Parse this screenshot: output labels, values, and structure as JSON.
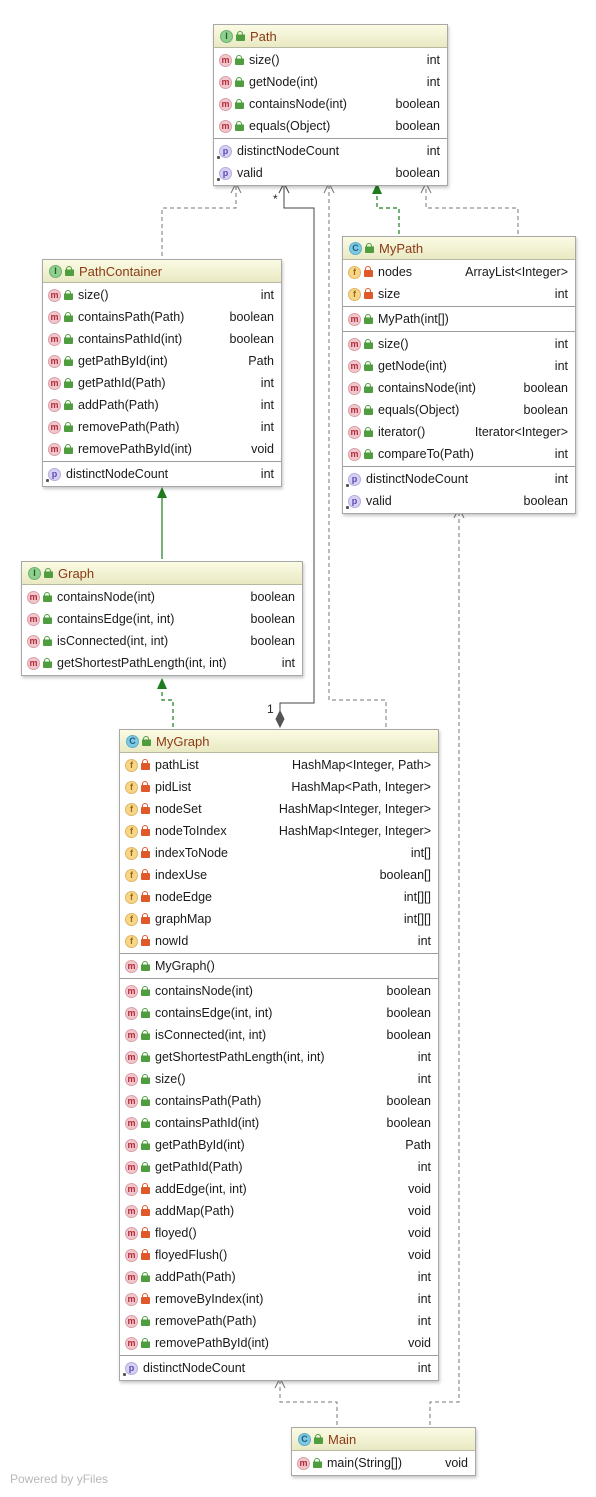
{
  "classes": {
    "path": {
      "kind": "I",
      "name": "Path",
      "methods": [
        {
          "name": "size()",
          "type": "int"
        },
        {
          "name": "getNode(int)",
          "type": "int"
        },
        {
          "name": "containsNode(int)",
          "type": "boolean"
        },
        {
          "name": "equals(Object)",
          "type": "boolean"
        }
      ],
      "properties": [
        {
          "name": "distinctNodeCount",
          "type": "int"
        },
        {
          "name": "valid",
          "type": "boolean"
        }
      ]
    },
    "pathcontainer": {
      "kind": "I",
      "name": "PathContainer",
      "methods": [
        {
          "name": "size()",
          "type": "int"
        },
        {
          "name": "containsPath(Path)",
          "type": "boolean"
        },
        {
          "name": "containsPathId(int)",
          "type": "boolean"
        },
        {
          "name": "getPathById(int)",
          "type": "Path"
        },
        {
          "name": "getPathId(Path)",
          "type": "int"
        },
        {
          "name": "addPath(Path)",
          "type": "int"
        },
        {
          "name": "removePath(Path)",
          "type": "int"
        },
        {
          "name": "removePathById(int)",
          "type": "void"
        }
      ],
      "properties": [
        {
          "name": "distinctNodeCount",
          "type": "int"
        }
      ]
    },
    "mypath": {
      "kind": "C",
      "name": "MyPath",
      "fields": [
        {
          "name": "nodes",
          "type": "ArrayList<Integer>"
        },
        {
          "name": "size",
          "type": "int"
        }
      ],
      "constructors": [
        {
          "name": "MyPath(int[])",
          "type": ""
        }
      ],
      "methods": [
        {
          "name": "size()",
          "type": "int"
        },
        {
          "name": "getNode(int)",
          "type": "int"
        },
        {
          "name": "containsNode(int)",
          "type": "boolean"
        },
        {
          "name": "equals(Object)",
          "type": "boolean"
        },
        {
          "name": "iterator()",
          "type": "Iterator<Integer>"
        },
        {
          "name": "compareTo(Path)",
          "type": "int"
        }
      ],
      "properties": [
        {
          "name": "distinctNodeCount",
          "type": "int"
        },
        {
          "name": "valid",
          "type": "boolean"
        }
      ]
    },
    "graph": {
      "kind": "I",
      "name": "Graph",
      "methods": [
        {
          "name": "containsNode(int)",
          "type": "boolean"
        },
        {
          "name": "containsEdge(int, int)",
          "type": "boolean"
        },
        {
          "name": "isConnected(int, int)",
          "type": "boolean"
        },
        {
          "name": "getShortestPathLength(int, int)",
          "type": "int"
        }
      ]
    },
    "mygraph": {
      "kind": "C",
      "name": "MyGraph",
      "fields": [
        {
          "name": "pathList",
          "type": "HashMap<Integer, Path>"
        },
        {
          "name": "pidList",
          "type": "HashMap<Path, Integer>"
        },
        {
          "name": "nodeSet",
          "type": "HashMap<Integer, Integer>"
        },
        {
          "name": "nodeToIndex",
          "type": "HashMap<Integer, Integer>"
        },
        {
          "name": "indexToNode",
          "type": "int[]"
        },
        {
          "name": "indexUse",
          "type": "boolean[]"
        },
        {
          "name": "nodeEdge",
          "type": "int[][]"
        },
        {
          "name": "graphMap",
          "type": "int[][]"
        },
        {
          "name": "nowId",
          "type": "int"
        }
      ],
      "constructors": [
        {
          "name": "MyGraph()",
          "type": ""
        }
      ],
      "methods": [
        {
          "name": "containsNode(int)",
          "type": "boolean",
          "vis": "pub"
        },
        {
          "name": "containsEdge(int, int)",
          "type": "boolean",
          "vis": "pub"
        },
        {
          "name": "isConnected(int, int)",
          "type": "boolean",
          "vis": "pub"
        },
        {
          "name": "getShortestPathLength(int, int)",
          "type": "int",
          "vis": "pub"
        },
        {
          "name": "size()",
          "type": "int",
          "vis": "pub"
        },
        {
          "name": "containsPath(Path)",
          "type": "boolean",
          "vis": "pub"
        },
        {
          "name": "containsPathId(int)",
          "type": "boolean",
          "vis": "pub"
        },
        {
          "name": "getPathById(int)",
          "type": "Path",
          "vis": "pub"
        },
        {
          "name": "getPathId(Path)",
          "type": "int",
          "vis": "pub"
        },
        {
          "name": "addEdge(int, int)",
          "type": "void",
          "vis": "priv"
        },
        {
          "name": "addMap(Path)",
          "type": "void",
          "vis": "priv"
        },
        {
          "name": "floyed()",
          "type": "void",
          "vis": "priv"
        },
        {
          "name": "floyedFlush()",
          "type": "void",
          "vis": "priv"
        },
        {
          "name": "addPath(Path)",
          "type": "int",
          "vis": "pub"
        },
        {
          "name": "removeByIndex(int)",
          "type": "int",
          "vis": "priv"
        },
        {
          "name": "removePath(Path)",
          "type": "int",
          "vis": "pub"
        },
        {
          "name": "removePathById(int)",
          "type": "void",
          "vis": "pub"
        }
      ],
      "properties": [
        {
          "name": "distinctNodeCount",
          "type": "int"
        }
      ]
    },
    "main": {
      "kind": "C",
      "name": "Main",
      "methods": [
        {
          "name": "main(String[])",
          "type": "void"
        }
      ]
    }
  },
  "multiplicities": {
    "many": "*",
    "one": "1"
  },
  "footer": "Powered by yFiles",
  "colors": {
    "realization": "#1e7d1e",
    "dependency": "#777777",
    "association": "#444444",
    "class_title": "#8b3a14"
  }
}
